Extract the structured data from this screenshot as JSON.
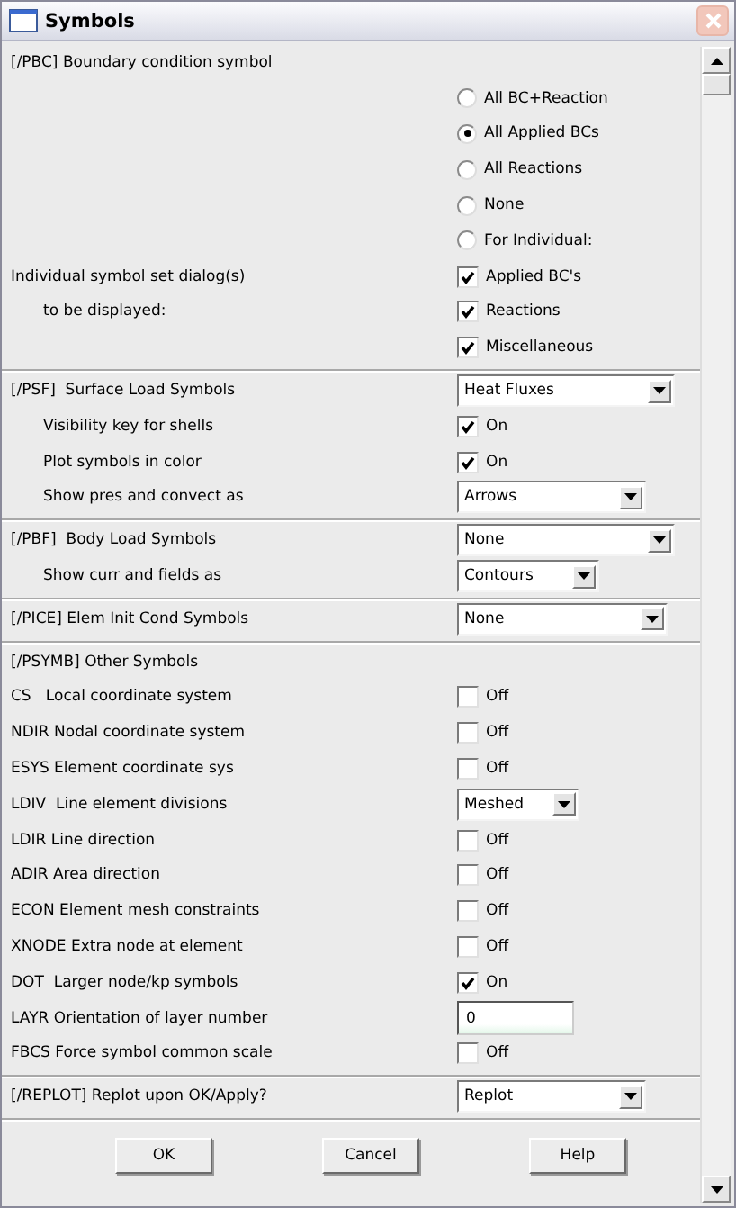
{
  "window": {
    "title": "Symbols"
  },
  "sections": [
    {
      "rows": [
        {
          "kind": "heading",
          "label": "[/PBC] Boundary condition symbol"
        },
        {
          "control": {
            "kind": "radio",
            "text": "All BC+Reaction",
            "selected": false
          }
        },
        {
          "control": {
            "kind": "radio",
            "text": "All Applied BCs",
            "selected": true
          }
        },
        {
          "control": {
            "kind": "radio",
            "text": "All Reactions",
            "selected": false
          }
        },
        {
          "control": {
            "kind": "radio",
            "text": "None",
            "selected": false
          }
        },
        {
          "control": {
            "kind": "radio",
            "text": "For Individual:",
            "selected": false
          }
        },
        {
          "kind": "heading",
          "label": "Individual symbol set dialog(s)",
          "control": {
            "kind": "checkbox",
            "text": "Applied BC's",
            "checked": true
          }
        },
        {
          "kind": "sub",
          "label": "to be displayed:",
          "control": {
            "kind": "checkbox",
            "text": "Reactions",
            "checked": true
          }
        },
        {
          "control": {
            "kind": "checkbox",
            "text": "Miscellaneous",
            "checked": true
          }
        }
      ]
    },
    {
      "rows": [
        {
          "kind": "heading",
          "label": "[/PSF]  Surface Load Symbols",
          "control": {
            "kind": "dropdown",
            "value": "Heat Fluxes"
          }
        },
        {
          "kind": "sub",
          "label": "Visibility key for shells",
          "control": {
            "kind": "checkbox",
            "text": "On",
            "checked": true
          }
        },
        {
          "kind": "sub",
          "label": "Plot symbols in color",
          "control": {
            "kind": "checkbox",
            "text": "On",
            "checked": true
          }
        },
        {
          "kind": "sub",
          "label": "Show pres and convect as",
          "control": {
            "kind": "dropdown",
            "value": "Arrows"
          }
        }
      ]
    },
    {
      "rows": [
        {
          "kind": "heading",
          "label": "[/PBF]  Body Load Symbols",
          "control": {
            "kind": "dropdown",
            "value": "None"
          }
        },
        {
          "kind": "sub",
          "label": "Show curr and fields as",
          "control": {
            "kind": "dropdown",
            "value": "Contours"
          }
        }
      ]
    },
    {
      "rows": [
        {
          "kind": "heading",
          "label": "[/PICE] Elem Init Cond Symbols",
          "control": {
            "kind": "dropdown",
            "value": "None"
          }
        }
      ]
    },
    {
      "rows": [
        {
          "kind": "heading",
          "label": "[/PSYMB] Other Symbols"
        },
        {
          "kind": "heading",
          "label": "CS   Local coordinate system",
          "control": {
            "kind": "checkbox",
            "text": "Off",
            "checked": false
          }
        },
        {
          "kind": "heading",
          "label": "NDIR Nodal coordinate system",
          "control": {
            "kind": "checkbox",
            "text": "Off",
            "checked": false
          }
        },
        {
          "kind": "heading",
          "label": "ESYS Element coordinate sys",
          "control": {
            "kind": "checkbox",
            "text": "Off",
            "checked": false
          }
        },
        {
          "kind": "heading",
          "label": "LDIV  Line element divisions",
          "control": {
            "kind": "dropdown",
            "value": "Meshed"
          }
        },
        {
          "kind": "heading",
          "label": "LDIR Line direction",
          "control": {
            "kind": "checkbox",
            "text": "Off",
            "checked": false
          }
        },
        {
          "kind": "heading",
          "label": "ADIR Area direction",
          "control": {
            "kind": "checkbox",
            "text": "Off",
            "checked": false
          }
        },
        {
          "kind": "heading",
          "label": "ECON Element mesh constraints",
          "control": {
            "kind": "checkbox",
            "text": "Off",
            "checked": false
          }
        },
        {
          "kind": "heading",
          "label": "XNODE Extra node at element",
          "control": {
            "kind": "checkbox",
            "text": "Off",
            "checked": false
          }
        },
        {
          "kind": "heading",
          "label": "DOT  Larger node/kp symbols",
          "control": {
            "kind": "checkbox",
            "text": "On",
            "checked": true
          }
        },
        {
          "kind": "heading",
          "label": "LAYR Orientation of layer number",
          "control": {
            "kind": "textfield",
            "value": "0"
          }
        },
        {
          "kind": "heading",
          "label": "FBCS Force symbol common scale",
          "control": {
            "kind": "checkbox",
            "text": "Off",
            "checked": false
          }
        }
      ]
    },
    {
      "rows": [
        {
          "kind": "heading",
          "label": "[/REPLOT] Replot upon OK/Apply?",
          "control": {
            "kind": "dropdown",
            "value": "Replot"
          }
        }
      ]
    }
  ],
  "buttons": [
    "OK",
    "Cancel",
    "Help"
  ]
}
